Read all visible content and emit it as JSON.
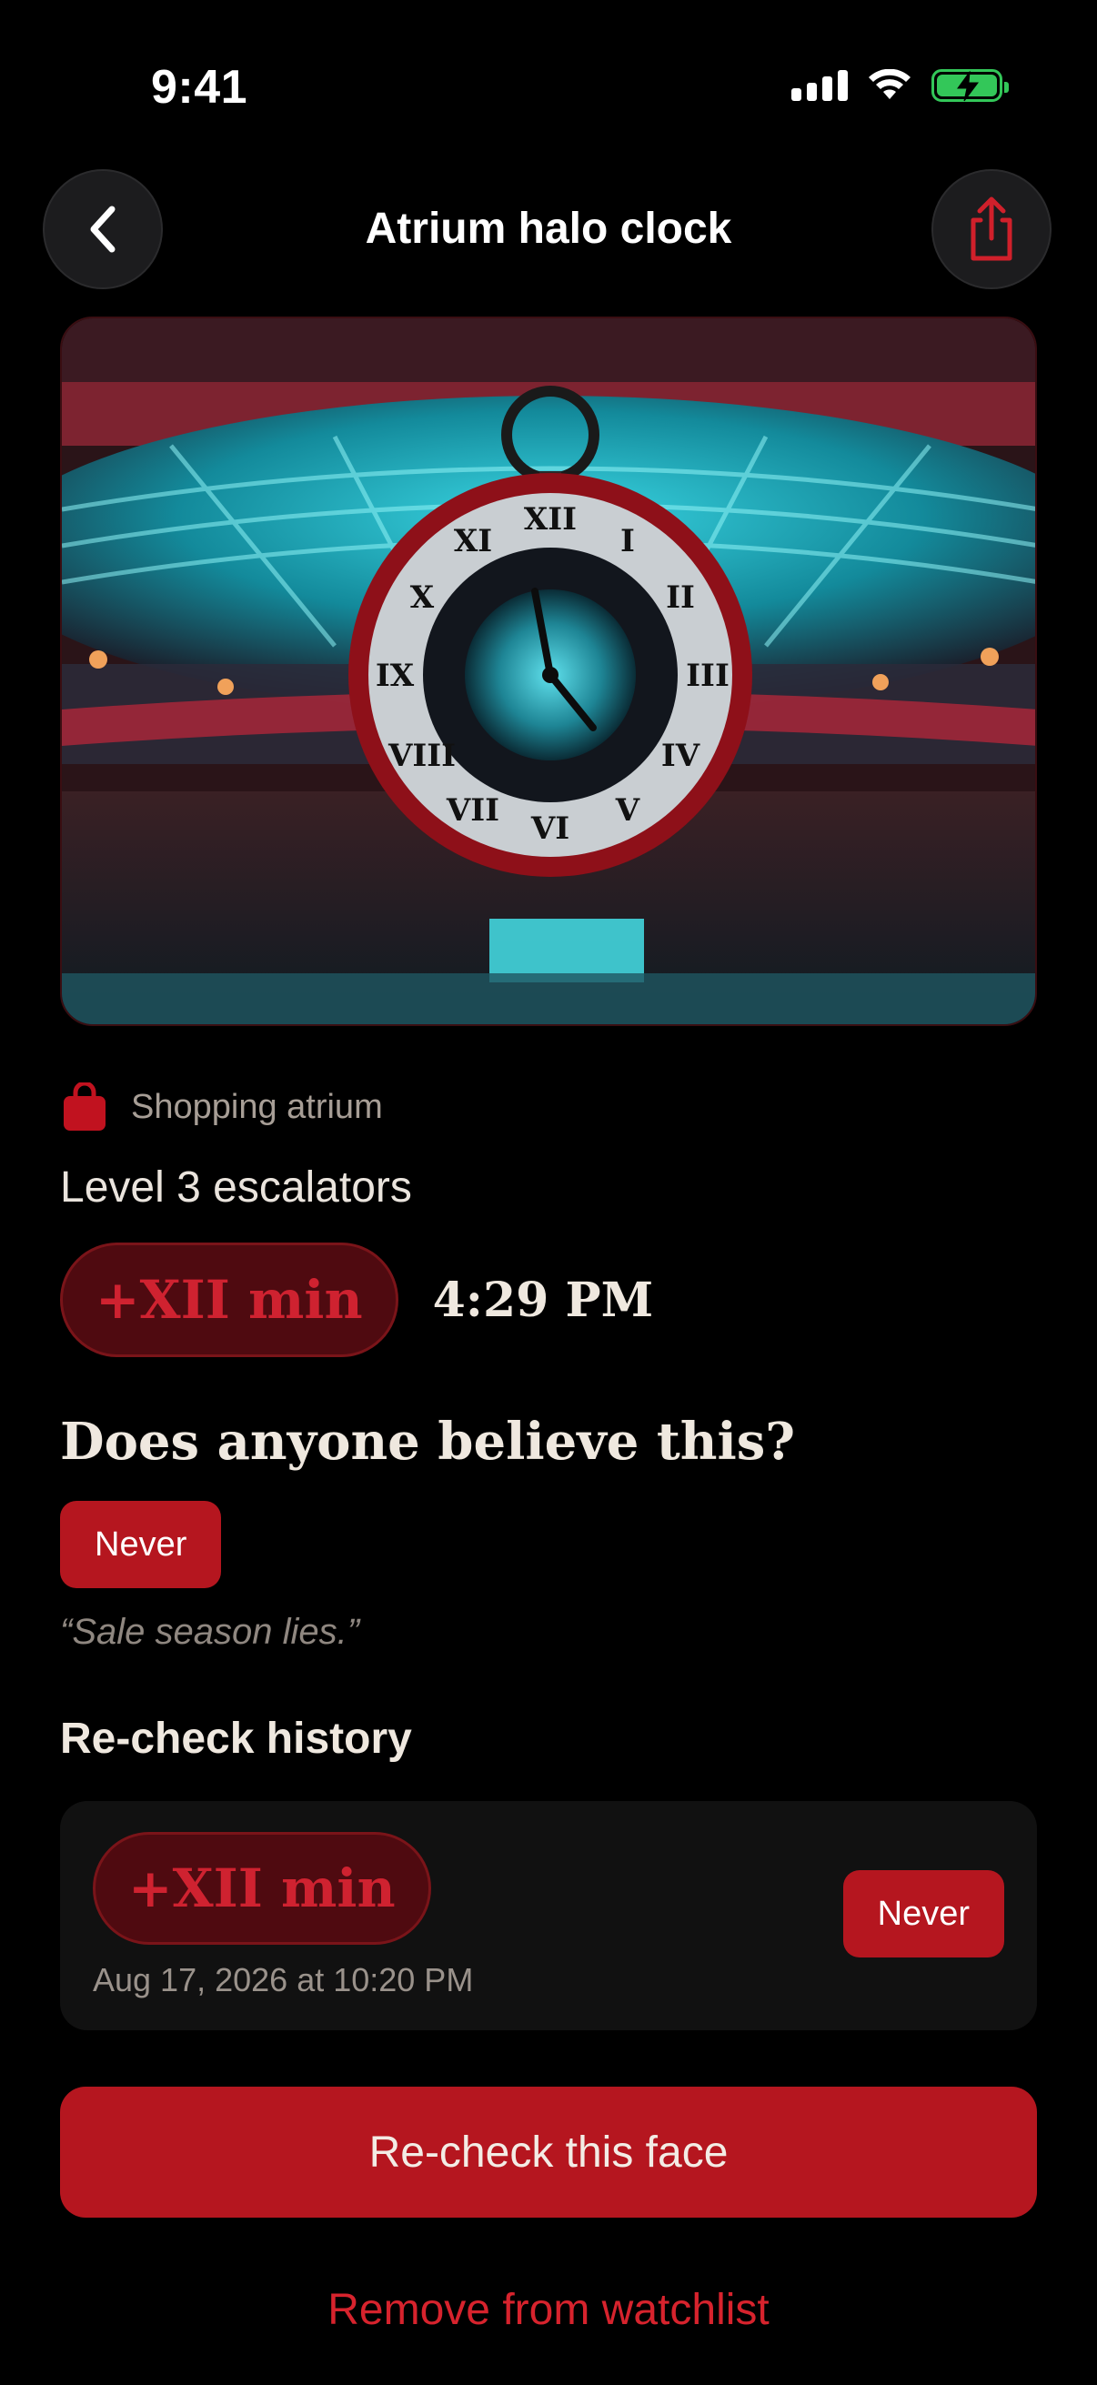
{
  "status_bar": {
    "time": "9:41",
    "icons": [
      "signal-icon",
      "wifi-icon",
      "battery-charging-icon"
    ]
  },
  "nav": {
    "title": "Atrium halo clock",
    "back_icon": "chevron-left-icon",
    "share_icon": "share-icon"
  },
  "hero": {
    "description_icon": "photo"
  },
  "clock": {
    "category_icon": "shopping-bag-icon",
    "category": "Shopping atrium",
    "location": "Level 3 escalators",
    "drift": "+XII min",
    "time": "4:29 PM"
  },
  "belief": {
    "question": "Does anyone believe this?",
    "verdict": "Never",
    "quote": "“Sale season lies.”"
  },
  "history": {
    "title": "Re-check history",
    "entries": [
      {
        "drift": "+XII min",
        "date": "Aug 17, 2026 at 10:20 PM",
        "verdict": "Never"
      }
    ]
  },
  "actions": {
    "recheck": "Re-check this face",
    "remove": "Remove from watchlist"
  },
  "colors": {
    "accent": "#b5161f",
    "drift_text": "#cf2230",
    "drift_bg": "#4f0a10",
    "background": "#000000",
    "battery": "#33c759"
  }
}
